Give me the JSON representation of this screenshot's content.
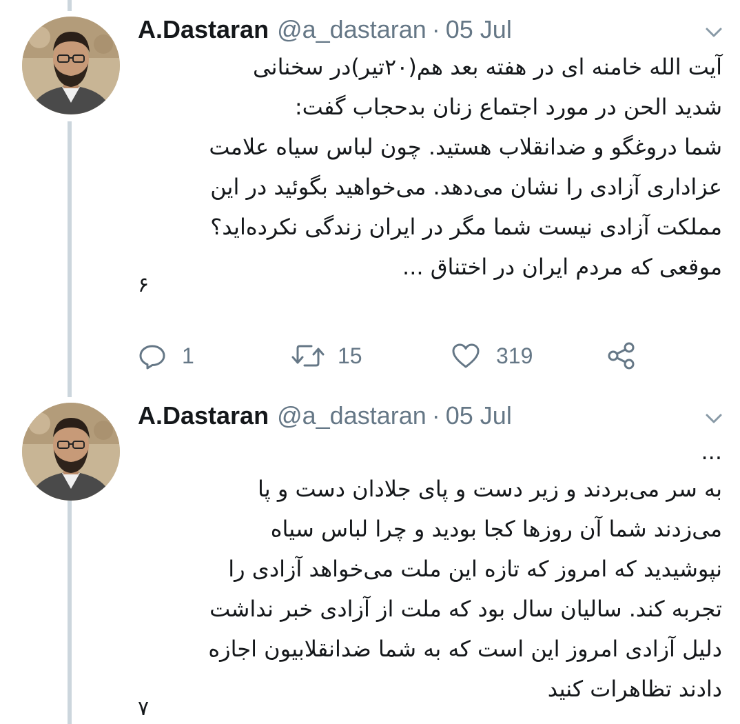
{
  "tweets": [
    {
      "name": "A.Dastaran",
      "handle": "@a_dastaran",
      "separator": "·",
      "date": "05 Jul",
      "lines": [
        "آیت الله خامنه ای در هفته بعد هم(۲۰تیر)در سخنانی",
        "شدید الحن در مورد اجتماع زنان بدحجاب گفت:",
        "شما دروغگو و ضدانقلاب هستید. چون لباس سیاه علامت",
        "عزاداری آزادی را نشان می‌دهد. می‌خواهید بگوئید در این",
        "مملکت آزادی نیست شما مگر در ایران زندگی نکرده‌اید؟",
        "موقعی که مردم ایران در اختناق ..."
      ],
      "page_number": "۶",
      "actions": {
        "reply_count": "1",
        "retweet_count": "15",
        "like_count": "319"
      },
      "icons": {
        "reply": "reply-icon",
        "retweet": "retweet-icon",
        "like": "heart-icon",
        "share": "share-icon",
        "caret": "chevron-down-icon"
      }
    },
    {
      "name": "A.Dastaran",
      "handle": "@a_dastaran",
      "separator": "·",
      "date": "05 Jul",
      "leading_ellipsis": "...",
      "lines": [
        "به سر می‌بردند و زیر دست و پای جلادان دست و پا",
        "می‌زدند شما آن روزها کجا بودید و چرا لباس سیاه",
        "نپوشیدید که امروز که تازه این ملت می‌خواهد آزادی را",
        "تجربه کند. سالیان سال بود که ملت از آزادی خبر نداشت",
        "دلیل آزادی امروز این است که به شما ضدانقلابیون اجازه",
        "دادند تظاهرات کنید"
      ],
      "page_number": "۷"
    }
  ],
  "colors": {
    "secondary_text": "#657786",
    "thread_line": "#ccd6dd",
    "primary_text": "#14171a"
  }
}
